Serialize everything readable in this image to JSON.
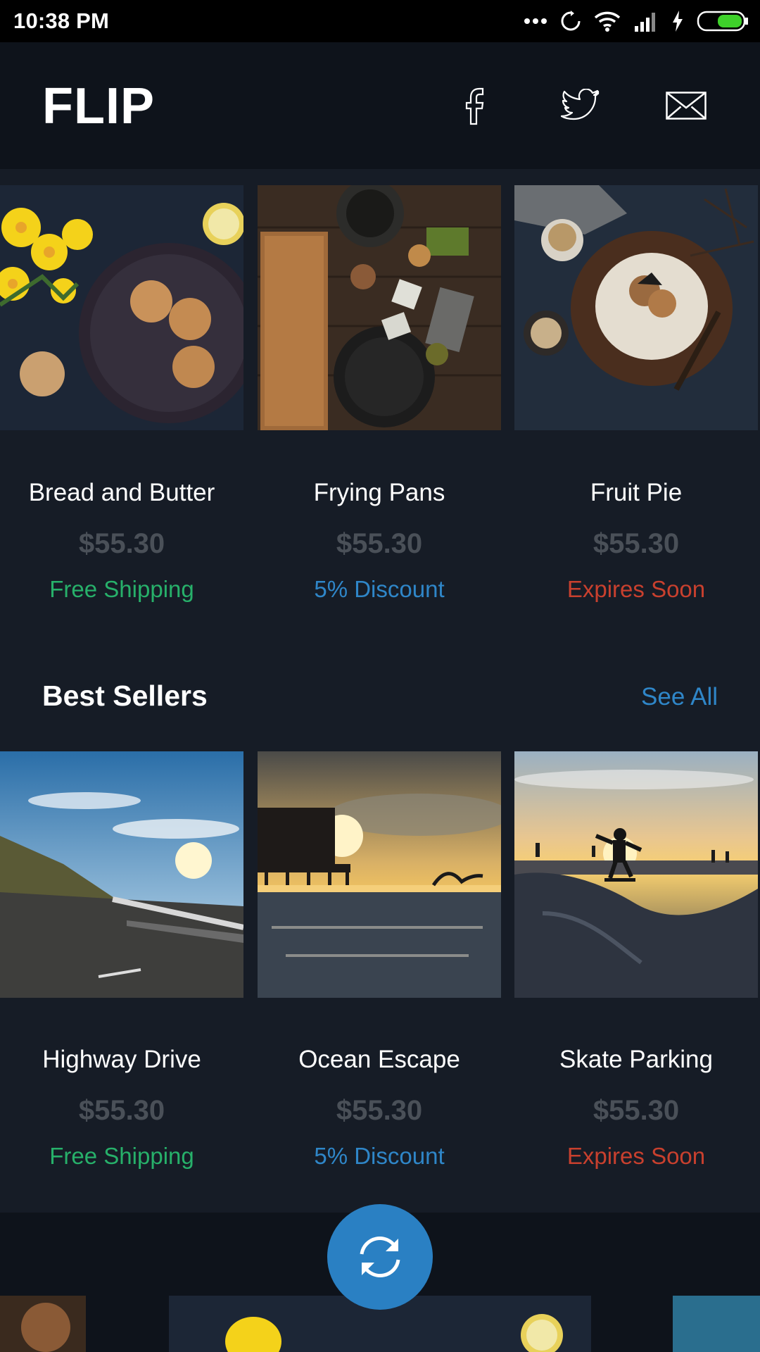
{
  "status": {
    "time": "10:38 PM"
  },
  "header": {
    "logo": "FLIP",
    "icons": [
      "facebook-icon",
      "twitter-icon",
      "mail-icon"
    ]
  },
  "featured": [
    {
      "name": "Bread and Butter",
      "price": "$55.30",
      "tag": "Free Shipping",
      "tag_color": "#27b06a"
    },
    {
      "name": "Frying Pans",
      "price": "$55.30",
      "tag": "5% Discount",
      "tag_color": "#2f86c8"
    },
    {
      "name": "Fruit Pie",
      "price": "$55.30",
      "tag": "Expires Soon",
      "tag_color": "#c8402e"
    }
  ],
  "best_sellers": {
    "title": "Best Sellers",
    "see_all": "See All",
    "items": [
      {
        "name": "Highway Drive",
        "price": "$55.30",
        "tag": "Free Shipping",
        "tag_color": "#27b06a"
      },
      {
        "name": "Ocean Escape",
        "price": "$55.30",
        "tag": "5% Discount",
        "tag_color": "#2f86c8"
      },
      {
        "name": "Skate Parking",
        "price": "$55.30",
        "tag": "Expires Soon",
        "tag_color": "#c8402e"
      }
    ]
  },
  "colors": {
    "background": "#161c26",
    "header": "#0e131b",
    "accent": "#2a80c3",
    "price": "#4a5058"
  }
}
